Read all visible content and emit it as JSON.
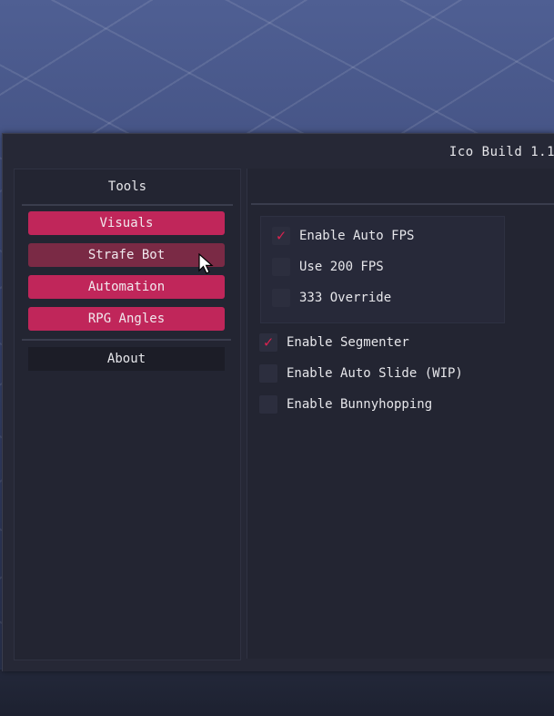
{
  "window": {
    "title": "Ico Build 1.1"
  },
  "sidebar": {
    "header": "Tools",
    "items": [
      {
        "label": "Visuals",
        "state": "normal"
      },
      {
        "label": "Strafe Bot",
        "state": "hover"
      },
      {
        "label": "Automation",
        "state": "normal"
      },
      {
        "label": "RPG Angles",
        "state": "normal"
      }
    ],
    "about_label": "About"
  },
  "options": {
    "fps_group": [
      {
        "label": "Enable Auto FPS",
        "checked": true
      },
      {
        "label": "Use 200 FPS",
        "checked": false
      },
      {
        "label": "333 Override",
        "checked": false
      }
    ],
    "general": [
      {
        "label": "Enable Segmenter",
        "checked": true
      },
      {
        "label": "Enable Auto Slide (WIP)",
        "checked": false
      },
      {
        "label": "Enable Bunnyhopping",
        "checked": false
      }
    ]
  },
  "colors": {
    "accent": "#c0265a",
    "accent_hover": "#7a2a45",
    "checkmark": "#d8234f",
    "panel": "#232532"
  }
}
